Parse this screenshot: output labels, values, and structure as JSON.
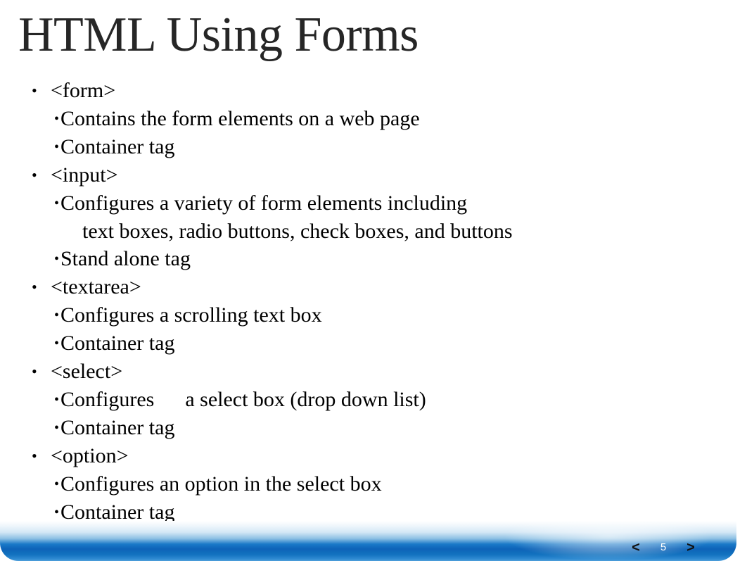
{
  "slide": {
    "title": "HTML Using Forms",
    "title_color": "#262626",
    "body_color": "#000000",
    "background_color": "#ffffff",
    "bullet_glyph": "•",
    "content": [
      {
        "level": 1,
        "text": "<form>"
      },
      {
        "level": 2,
        "text": "Contains the form elements on a web page"
      },
      {
        "level": 2,
        "text": "Container tag"
      },
      {
        "level": 1,
        "text": "<input>"
      },
      {
        "level": 2,
        "text": "Configures a variety of form elements including"
      },
      {
        "level": "cont",
        "text": "text boxes, radio buttons, check boxes, and buttons"
      },
      {
        "level": 2,
        "text": "Stand alone tag"
      },
      {
        "level": 1,
        "text": "<textarea>"
      },
      {
        "level": 2,
        "text": "Configures a scrolling text box"
      },
      {
        "level": 2,
        "text": "Container tag"
      },
      {
        "level": 1,
        "text": "<select>"
      },
      {
        "level": 2,
        "text_before_gap": "Configures",
        "text_after_gap": "a select box (drop down list)"
      },
      {
        "level": 2,
        "text": "Container tag"
      },
      {
        "level": 1,
        "text": "<option>"
      },
      {
        "level": 2,
        "text": "Configures an option in the select box"
      },
      {
        "level": 2,
        "text": "Container tag"
      }
    ]
  },
  "navbar": {
    "prev_label": "<",
    "page_label": "5",
    "next_label": ">",
    "bar_color_light": "#d5e8f6",
    "bar_color_dark": "#0d63b8",
    "page_text_color": "#ffffff",
    "arrow_color": "#111111"
  }
}
